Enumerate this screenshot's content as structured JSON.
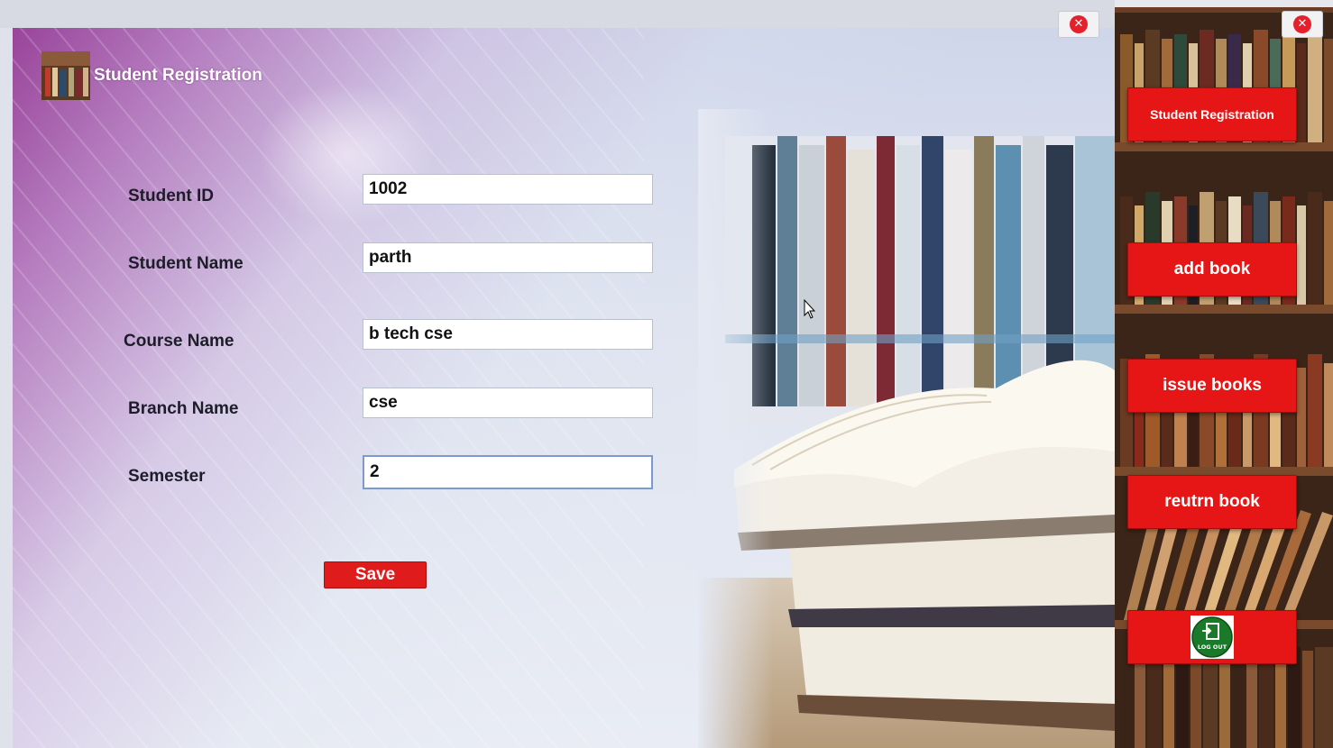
{
  "window": {
    "title": "Student Registration",
    "close_glyph": "✕"
  },
  "form": {
    "fields": [
      {
        "label": "Student ID",
        "value": "1002"
      },
      {
        "label": "Student Name",
        "value": "parth"
      },
      {
        "label": "Course Name",
        "value": "b tech cse"
      },
      {
        "label": "Branch Name",
        "value": "cse"
      },
      {
        "label": "Semester",
        "value": "2"
      }
    ],
    "save_label": "Save"
  },
  "sidebar": {
    "close_glyph": "✕",
    "buttons": [
      {
        "label": "Student Registration"
      },
      {
        "label": "add book"
      },
      {
        "label": "issue books"
      },
      {
        "label": "reutrn book"
      }
    ],
    "logout": {
      "icon": "logout-icon",
      "icon_text": "LOG OUT"
    }
  },
  "colors": {
    "accent_red": "#e61616",
    "close_red": "#e5202a",
    "logout_green": "#1a7a2a"
  }
}
